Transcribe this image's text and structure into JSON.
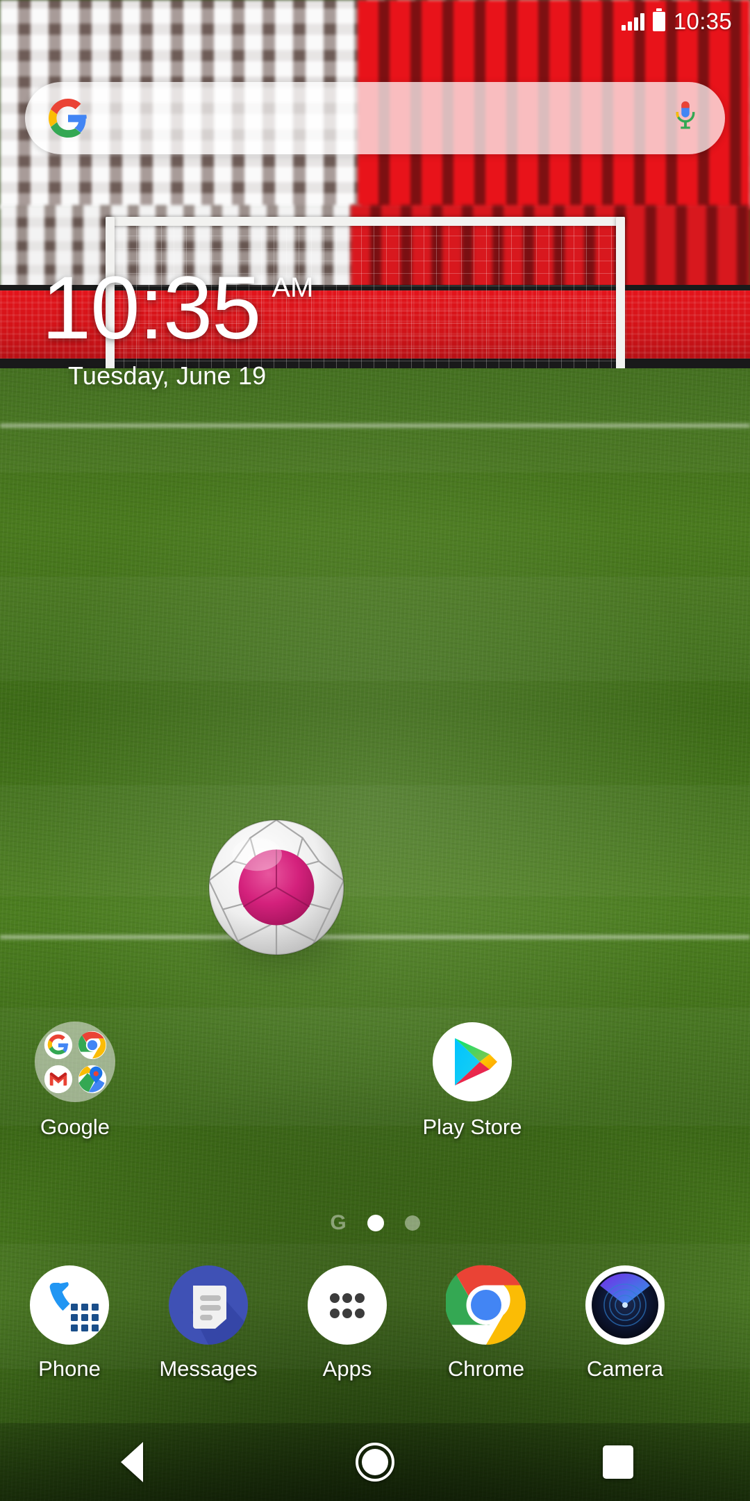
{
  "status_bar": {
    "clock": "10:35",
    "signal_icon": "signal-bars-icon",
    "battery_icon": "battery-icon",
    "signal_bars": 4
  },
  "search_widget": {
    "logo_icon": "google-g-logo-icon",
    "mic_icon": "microphone-icon",
    "placeholder": ""
  },
  "clock_widget": {
    "time": "10:35",
    "ampm": "AM",
    "date": "Tuesday, June 19"
  },
  "home_apps": [
    {
      "label": "Google",
      "icon": "google-folder-icon",
      "type": "folder",
      "folder_items": [
        "google-g-icon",
        "chrome-icon",
        "gmail-icon",
        "maps-icon"
      ]
    },
    {
      "label": "Play Store",
      "icon": "play-store-icon",
      "type": "app"
    }
  ],
  "page_indicator": {
    "google_glyph": "G",
    "pages": 2,
    "active_page": 1
  },
  "dock": [
    {
      "label": "Phone",
      "icon": "phone-icon"
    },
    {
      "label": "Messages",
      "icon": "messages-icon"
    },
    {
      "label": "Apps",
      "icon": "apps-grid-icon"
    },
    {
      "label": "Chrome",
      "icon": "chrome-icon"
    },
    {
      "label": "Camera",
      "icon": "camera-icon"
    }
  ],
  "nav_bar": {
    "back": "back-icon",
    "home": "home-icon",
    "recents": "recents-icon"
  },
  "wallpaper": {
    "description": "soccer-stadium-wallpaper",
    "ball_icon": "soccer-ball-japan-flag-icon",
    "colors": {
      "grass": "#45761c",
      "stand_red": "#d4161c",
      "ball_center": "#d4217c"
    }
  }
}
